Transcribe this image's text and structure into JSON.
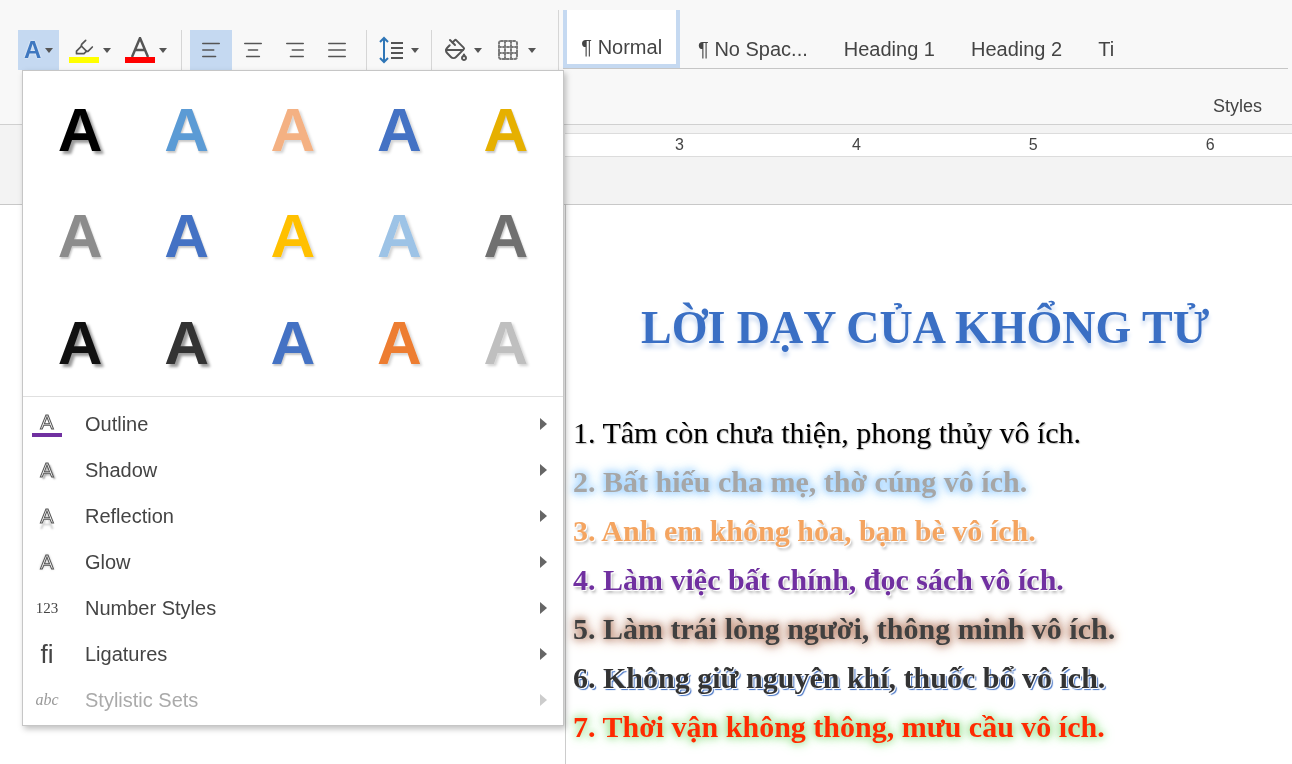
{
  "toolbar": {
    "text_effects": {
      "label": "A",
      "selected": true
    },
    "align": [
      {
        "kind": "left",
        "selected": true
      },
      {
        "kind": "center",
        "selected": false
      },
      {
        "kind": "right",
        "selected": false
      },
      {
        "kind": "justify",
        "selected": false
      }
    ]
  },
  "styles": {
    "items": [
      {
        "label": "¶ Normal",
        "selected": true
      },
      {
        "label": "¶ No Spac...",
        "selected": false
      },
      {
        "label": "Heading 1",
        "selected": false
      },
      {
        "label": "Heading 2",
        "selected": false
      },
      {
        "label": "Ti",
        "selected": false
      }
    ],
    "group_label": "Styles"
  },
  "ruler": {
    "numbers": [
      "3",
      "4",
      "5",
      "6"
    ]
  },
  "effects_menu": {
    "gallery": [
      {
        "label": "A",
        "kind": "shadow",
        "color": "#000000"
      },
      {
        "label": "A",
        "kind": "fill",
        "color": "#5b9bd5"
      },
      {
        "label": "A",
        "kind": "outline",
        "color": "#f4b183"
      },
      {
        "label": "A",
        "kind": "outline",
        "color": "#4472c4"
      },
      {
        "label": "A",
        "kind": "fill",
        "color": "#e6b000"
      },
      {
        "label": "A",
        "kind": "fill",
        "color": "#8c8c8c"
      },
      {
        "label": "A",
        "kind": "fill",
        "color": "#4472c4"
      },
      {
        "label": "A",
        "kind": "outline",
        "color": "#ffc000"
      },
      {
        "label": "A",
        "kind": "outline",
        "color": "#9dc3e6"
      },
      {
        "label": "A",
        "kind": "fill",
        "color": "#707070"
      },
      {
        "label": "A",
        "kind": "shadow",
        "color": "#111111"
      },
      {
        "label": "A",
        "kind": "shadow",
        "color": "#333333"
      },
      {
        "label": "A",
        "kind": "fill",
        "color": "#4472c4"
      },
      {
        "label": "A",
        "kind": "outline",
        "color": "#ed7d31"
      },
      {
        "label": "A",
        "kind": "outline",
        "color": "#bfbfbf"
      }
    ],
    "items": [
      {
        "icon": "A",
        "kind": "outline",
        "label": "Outline",
        "disabled": false
      },
      {
        "icon": "A",
        "kind": "shadow",
        "label": "Shadow",
        "disabled": false
      },
      {
        "icon": "A",
        "kind": "reflection",
        "label": "Reflection",
        "disabled": false
      },
      {
        "icon": "A",
        "kind": "glow",
        "label": "Glow",
        "disabled": false
      },
      {
        "icon": "123",
        "kind": "numbers",
        "label": "Number Styles",
        "disabled": false
      },
      {
        "icon": "fi",
        "kind": "ligature",
        "label": "Ligatures",
        "disabled": false
      },
      {
        "icon": "abc",
        "kind": "stylistic",
        "label": "Stylistic Sets",
        "disabled": true
      }
    ]
  },
  "document": {
    "title": "LỜI DẠY CỦA KHỔNG TỬ",
    "lines": [
      {
        "text": "1. Tâm còn chưa thiện, phong thủy vô ích.",
        "color": "#000000",
        "kind": "plain"
      },
      {
        "text": "2. Bất hiếu cha mẹ, thờ cúng vô ích.",
        "color": "#a6a6a6",
        "kind": "glow-blue"
      },
      {
        "text": "3. Anh em không hòa, bạn bè vô ích.",
        "color": "#f4a460",
        "kind": "outline"
      },
      {
        "text": "4. Làm việc bất chính, đọc sách vô ích.",
        "color": "#7030a0",
        "kind": "outline"
      },
      {
        "text": "5. Làm trái lòng người, thông minh vô ích.",
        "color": "#404040",
        "kind": "glow-brown"
      },
      {
        "text": "6. Không giữ nguyên khí, thuốc bổ vô ích.",
        "color": "#333333",
        "kind": "shadow"
      },
      {
        "text": "7. Thời vận không thông, mưu cầu vô ích.",
        "color": "#ff2a00",
        "kind": "glow-green"
      }
    ]
  }
}
